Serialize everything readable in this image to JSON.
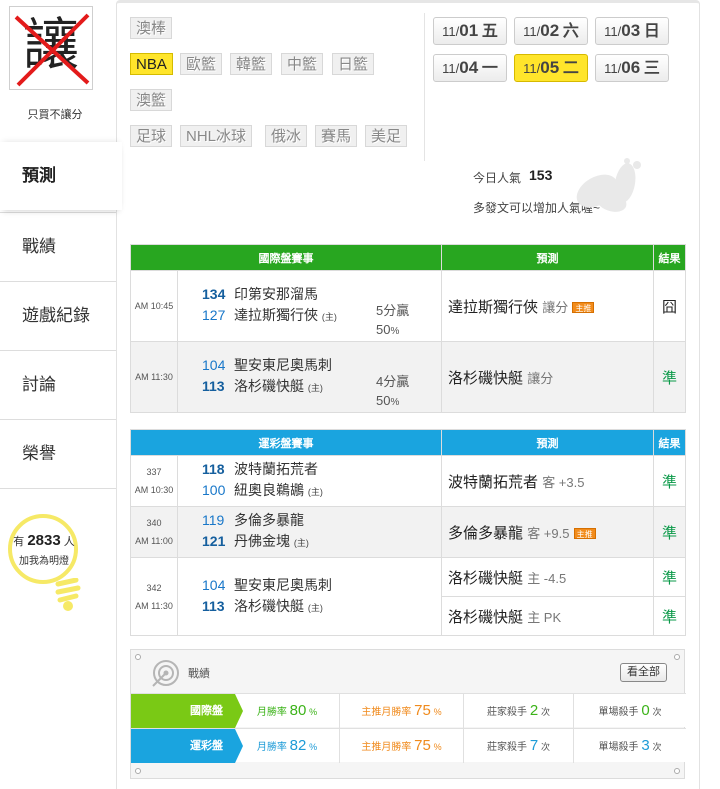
{
  "sidebar": {
    "avatar_text": "讓",
    "avatar_caption": "只買不讓分",
    "nav": [
      {
        "label": "預測"
      },
      {
        "label": "戰績"
      },
      {
        "label": "遊戲紀錄"
      },
      {
        "label": "討論"
      },
      {
        "label": "榮譽"
      }
    ],
    "bulb": {
      "prefix": "有",
      "count": "2833",
      "suffix": "人",
      "caption": "加我為明燈"
    }
  },
  "leagues": [
    {
      "label": "澳棒",
      "active": false
    },
    {
      "label": "NBA",
      "active": true
    },
    {
      "label": "歐籃",
      "active": false
    },
    {
      "label": "韓籃",
      "active": false
    },
    {
      "label": "中籃",
      "active": false
    },
    {
      "label": "日籃",
      "active": false
    },
    {
      "label": "澳籃",
      "active": false
    },
    {
      "label": "足球",
      "active": false
    },
    {
      "label": "NHL冰球",
      "active": false
    },
    {
      "label": "俄冰",
      "active": false
    },
    {
      "label": "賽馬",
      "active": false
    },
    {
      "label": "美足",
      "active": false
    }
  ],
  "dates": [
    {
      "month": "11/",
      "day": "01",
      "weekday": "五",
      "active": false
    },
    {
      "month": "11/",
      "day": "02",
      "weekday": "六",
      "active": false
    },
    {
      "month": "11/",
      "day": "03",
      "weekday": "日",
      "active": false
    },
    {
      "month": "11/",
      "day": "04",
      "weekday": "一",
      "active": false
    },
    {
      "month": "11/",
      "day": "05",
      "weekday": "二",
      "active": true
    },
    {
      "month": "11/",
      "day": "06",
      "weekday": "三",
      "active": false
    }
  ],
  "popularity": {
    "label": "今日人氣",
    "value": "153",
    "note": "多發文可以增加人氣喔~"
  },
  "intl_table": {
    "headers": [
      "國際盤賽事",
      "預測",
      "結果"
    ],
    "rows": [
      {
        "time": "AM 10:45",
        "away_num": "134",
        "away": "印第安那溜馬",
        "home_num": "127",
        "home": "達拉斯獨行俠",
        "home_mark": "(主)",
        "spread": "5分贏",
        "pct": "50",
        "pct_unit": "%",
        "pick": "達拉斯獨行俠",
        "pick_sub": "讓分",
        "badge": "主推",
        "result": "囧"
      },
      {
        "time": "AM 11:30",
        "away_num": "104",
        "away": "聖安東尼奧馬刺",
        "home_num": "113",
        "home": "洛杉磯快艇",
        "home_mark": "(主)",
        "spread": "4分贏",
        "pct": "50",
        "pct_unit": "%",
        "pick": "洛杉磯快艇",
        "pick_sub": "讓分",
        "result": "準"
      }
    ]
  },
  "lottery_table": {
    "headers": [
      "運彩盤賽事",
      "預測",
      "結果"
    ],
    "rows": [
      {
        "code": "337",
        "time": "AM 10:30",
        "away_num": "118",
        "away": "波特蘭拓荒者",
        "home_num": "100",
        "home": "紐奧良鵜鶘",
        "home_mark": "(主)",
        "pick": "波特蘭拓荒者",
        "pick_sub": "客 +3.5",
        "result": "準"
      },
      {
        "code": "340",
        "time": "AM 11:00",
        "away_num": "119",
        "away": "多倫多暴龍",
        "home_num": "121",
        "home": "丹佛金塊",
        "home_mark": "(主)",
        "pick": "多倫多暴龍",
        "pick_sub": "客 +9.5",
        "badge": "主推",
        "result": "準"
      },
      {
        "code": "342",
        "time": "AM 11:30",
        "away_num": "104",
        "away": "聖安東尼奧馬刺",
        "home_num": "113",
        "home": "洛杉磯快艇",
        "home_mark": "(主)",
        "pick1": "洛杉磯快艇",
        "pick1_sub": "主 -4.5",
        "result1": "準",
        "pick2": "洛杉磯快艇",
        "pick2_sub": "主 PK",
        "result2": "準"
      }
    ]
  },
  "record": {
    "title": "戰績",
    "view_all": "看全部",
    "rows": [
      {
        "label": "國際盤",
        "color": "#7ac915",
        "month_rate_label": "月勝率",
        "month_rate": "80",
        "pct": "%",
        "top_rate_label": "主推月勝率",
        "top_rate": "75",
        "banker_label": "莊家殺手",
        "banker": "2",
        "times": "次",
        "single_label": "單場殺手",
        "single": "0"
      },
      {
        "label": "運彩盤",
        "color": "#1aa4df",
        "month_rate_label": "月勝率",
        "month_rate": "82",
        "pct": "%",
        "top_rate_label": "主推月勝率",
        "top_rate": "75",
        "banker_label": "莊家殺手",
        "banker": "7",
        "times": "次",
        "single_label": "單場殺手",
        "single": "3"
      }
    ]
  }
}
